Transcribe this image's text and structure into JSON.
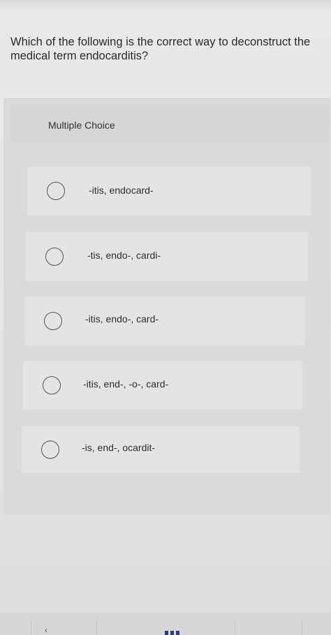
{
  "question": {
    "text": "Which of the following is the correct way to deconstruct the medical term endocarditis?"
  },
  "answer_panel": {
    "type_label": "Multiple Choice",
    "options": [
      {
        "label": "-itis, endocard-"
      },
      {
        "label": "-tis, endo-, cardi-"
      },
      {
        "label": "-itis, endo-, card-"
      },
      {
        "label": "-itis, end-, -o-, card-"
      },
      {
        "label": "-is, end-, ocardit-"
      }
    ]
  },
  "bottom_nav": {
    "prev_icon": "chevron-left-icon",
    "grid_icon": "grid-icon"
  },
  "colors": {
    "page_background": "#e6e6e6",
    "panel_background": "#dadada",
    "option_background": "#e4e4e4",
    "text": "#2b2b2b",
    "grid_icon": "#2d3f7a"
  }
}
